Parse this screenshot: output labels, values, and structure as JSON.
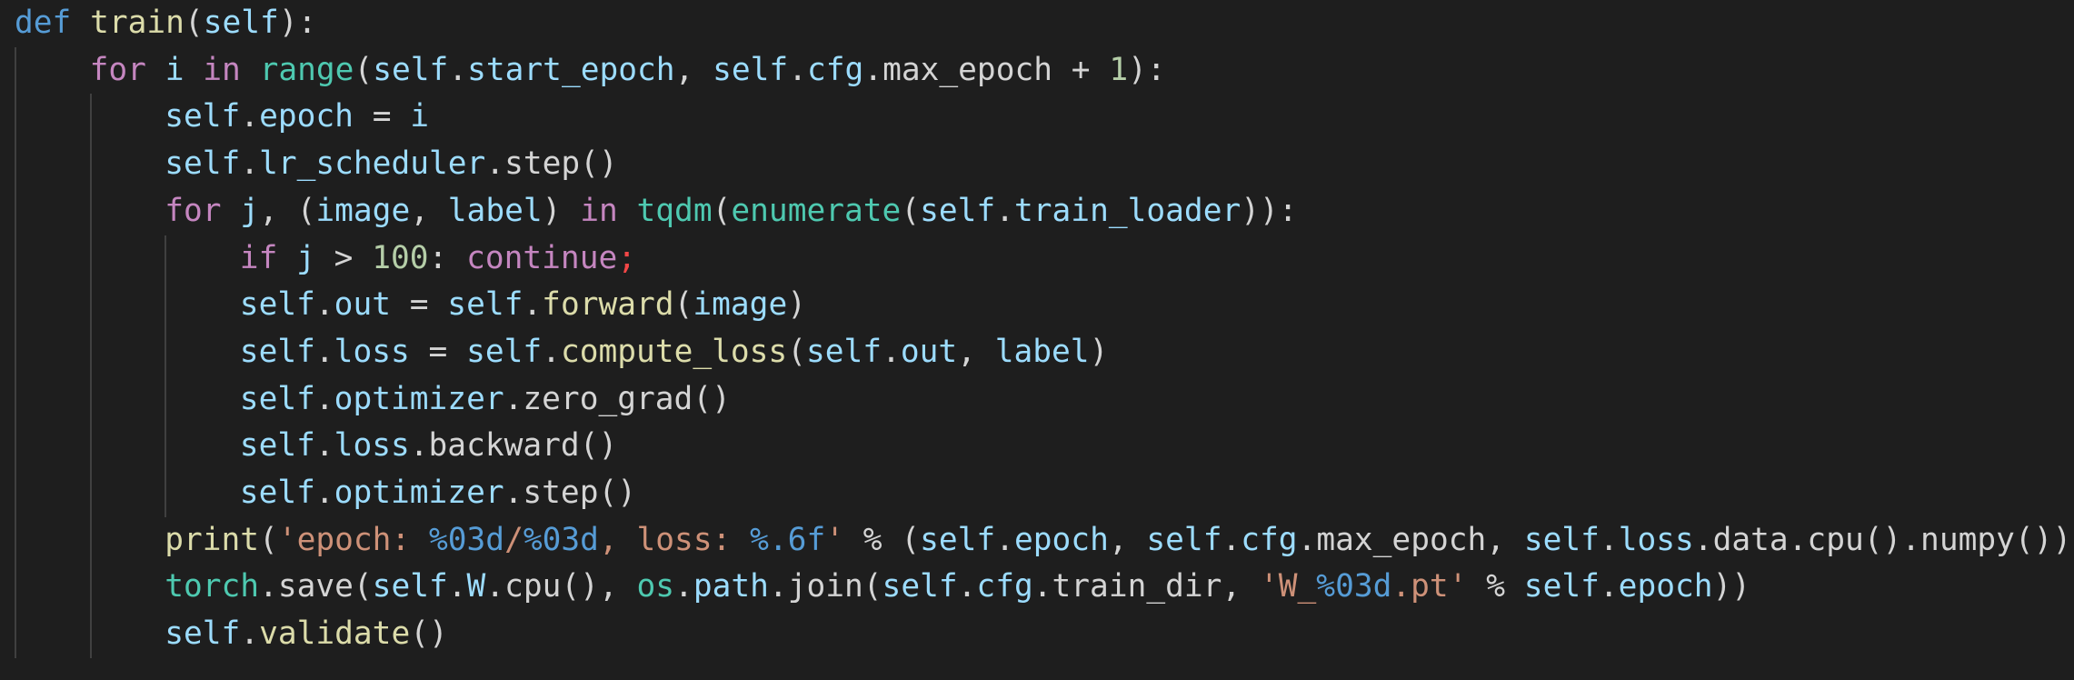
{
  "colors": {
    "background": "#1e1e1e",
    "indent_guide": "#404040",
    "kw_def": "#569cd6",
    "kw_control": "#c586c0",
    "function": "#dcdcaa",
    "variable": "#9cdcfe",
    "builtin_or_module": "#4ec9b0",
    "number": "#b5cea8",
    "string": "#ce9178",
    "format_spec": "#569cd6",
    "punctuation": "#d4d4d4",
    "semicolon_error": "#f44747"
  },
  "code": {
    "lines": [
      {
        "indent": 0,
        "tokens": [
          {
            "t": "def",
            "c": "kw_def"
          },
          {
            "t": " ",
            "c": "punctuation"
          },
          {
            "t": "train",
            "c": "function"
          },
          {
            "t": "(",
            "c": "punctuation"
          },
          {
            "t": "self",
            "c": "variable"
          },
          {
            "t": "):",
            "c": "punctuation"
          }
        ]
      },
      {
        "indent": 1,
        "tokens": [
          {
            "t": "for",
            "c": "kw_control"
          },
          {
            "t": " ",
            "c": "punctuation"
          },
          {
            "t": "i",
            "c": "variable"
          },
          {
            "t": " ",
            "c": "punctuation"
          },
          {
            "t": "in",
            "c": "kw_control"
          },
          {
            "t": " ",
            "c": "punctuation"
          },
          {
            "t": "range",
            "c": "builtin_or_module"
          },
          {
            "t": "(",
            "c": "punctuation"
          },
          {
            "t": "self",
            "c": "variable"
          },
          {
            "t": ".",
            "c": "punctuation"
          },
          {
            "t": "start_epoch",
            "c": "variable"
          },
          {
            "t": ", ",
            "c": "punctuation"
          },
          {
            "t": "self",
            "c": "variable"
          },
          {
            "t": ".",
            "c": "punctuation"
          },
          {
            "t": "cfg",
            "c": "variable"
          },
          {
            "t": ".max_epoch + ",
            "c": "punctuation"
          },
          {
            "t": "1",
            "c": "number"
          },
          {
            "t": "):",
            "c": "punctuation"
          }
        ]
      },
      {
        "indent": 2,
        "tokens": [
          {
            "t": "self",
            "c": "variable"
          },
          {
            "t": ".",
            "c": "punctuation"
          },
          {
            "t": "epoch",
            "c": "variable"
          },
          {
            "t": " = ",
            "c": "punctuation"
          },
          {
            "t": "i",
            "c": "variable"
          }
        ]
      },
      {
        "indent": 2,
        "tokens": [
          {
            "t": "self",
            "c": "variable"
          },
          {
            "t": ".",
            "c": "punctuation"
          },
          {
            "t": "lr_scheduler",
            "c": "variable"
          },
          {
            "t": ".step()",
            "c": "punctuation"
          }
        ]
      },
      {
        "indent": 2,
        "tokens": [
          {
            "t": "for",
            "c": "kw_control"
          },
          {
            "t": " ",
            "c": "punctuation"
          },
          {
            "t": "j",
            "c": "variable"
          },
          {
            "t": ", (",
            "c": "punctuation"
          },
          {
            "t": "image",
            "c": "variable"
          },
          {
            "t": ", ",
            "c": "punctuation"
          },
          {
            "t": "label",
            "c": "variable"
          },
          {
            "t": ") ",
            "c": "punctuation"
          },
          {
            "t": "in",
            "c": "kw_control"
          },
          {
            "t": " ",
            "c": "punctuation"
          },
          {
            "t": "tqdm",
            "c": "builtin_or_module"
          },
          {
            "t": "(",
            "c": "punctuation"
          },
          {
            "t": "enumerate",
            "c": "builtin_or_module"
          },
          {
            "t": "(",
            "c": "punctuation"
          },
          {
            "t": "self",
            "c": "variable"
          },
          {
            "t": ".",
            "c": "punctuation"
          },
          {
            "t": "train_loader",
            "c": "variable"
          },
          {
            "t": ")):",
            "c": "punctuation"
          }
        ]
      },
      {
        "indent": 3,
        "tokens": [
          {
            "t": "if",
            "c": "kw_control"
          },
          {
            "t": " ",
            "c": "punctuation"
          },
          {
            "t": "j",
            "c": "variable"
          },
          {
            "t": " > ",
            "c": "punctuation"
          },
          {
            "t": "100",
            "c": "number"
          },
          {
            "t": ": ",
            "c": "punctuation"
          },
          {
            "t": "continue",
            "c": "kw_control"
          },
          {
            "t": ";",
            "c": "semicolon_error"
          }
        ]
      },
      {
        "indent": 3,
        "tokens": [
          {
            "t": "self",
            "c": "variable"
          },
          {
            "t": ".",
            "c": "punctuation"
          },
          {
            "t": "out",
            "c": "variable"
          },
          {
            "t": " = ",
            "c": "punctuation"
          },
          {
            "t": "self",
            "c": "variable"
          },
          {
            "t": ".",
            "c": "punctuation"
          },
          {
            "t": "forward",
            "c": "function"
          },
          {
            "t": "(",
            "c": "punctuation"
          },
          {
            "t": "image",
            "c": "variable"
          },
          {
            "t": ")",
            "c": "punctuation"
          }
        ]
      },
      {
        "indent": 3,
        "tokens": [
          {
            "t": "self",
            "c": "variable"
          },
          {
            "t": ".",
            "c": "punctuation"
          },
          {
            "t": "loss",
            "c": "variable"
          },
          {
            "t": " = ",
            "c": "punctuation"
          },
          {
            "t": "self",
            "c": "variable"
          },
          {
            "t": ".",
            "c": "punctuation"
          },
          {
            "t": "compute_loss",
            "c": "function"
          },
          {
            "t": "(",
            "c": "punctuation"
          },
          {
            "t": "self",
            "c": "variable"
          },
          {
            "t": ".",
            "c": "punctuation"
          },
          {
            "t": "out",
            "c": "variable"
          },
          {
            "t": ", ",
            "c": "punctuation"
          },
          {
            "t": "label",
            "c": "variable"
          },
          {
            "t": ")",
            "c": "punctuation"
          }
        ]
      },
      {
        "indent": 3,
        "tokens": [
          {
            "t": "self",
            "c": "variable"
          },
          {
            "t": ".",
            "c": "punctuation"
          },
          {
            "t": "optimizer",
            "c": "variable"
          },
          {
            "t": ".zero_grad()",
            "c": "punctuation"
          }
        ]
      },
      {
        "indent": 3,
        "tokens": [
          {
            "t": "self",
            "c": "variable"
          },
          {
            "t": ".",
            "c": "punctuation"
          },
          {
            "t": "loss",
            "c": "variable"
          },
          {
            "t": ".backward()",
            "c": "punctuation"
          }
        ]
      },
      {
        "indent": 3,
        "tokens": [
          {
            "t": "self",
            "c": "variable"
          },
          {
            "t": ".",
            "c": "punctuation"
          },
          {
            "t": "optimizer",
            "c": "variable"
          },
          {
            "t": ".step()",
            "c": "punctuation"
          }
        ]
      },
      {
        "indent": 2,
        "tokens": [
          {
            "t": "print",
            "c": "function"
          },
          {
            "t": "(",
            "c": "punctuation"
          },
          {
            "t": "'epoch: ",
            "c": "string"
          },
          {
            "t": "%03d",
            "c": "format_spec"
          },
          {
            "t": "/",
            "c": "string"
          },
          {
            "t": "%03d",
            "c": "format_spec"
          },
          {
            "t": ", loss: ",
            "c": "string"
          },
          {
            "t": "%.6f",
            "c": "format_spec"
          },
          {
            "t": "'",
            "c": "string"
          },
          {
            "t": " % (",
            "c": "punctuation"
          },
          {
            "t": "self",
            "c": "variable"
          },
          {
            "t": ".",
            "c": "punctuation"
          },
          {
            "t": "epoch",
            "c": "variable"
          },
          {
            "t": ", ",
            "c": "punctuation"
          },
          {
            "t": "self",
            "c": "variable"
          },
          {
            "t": ".",
            "c": "punctuation"
          },
          {
            "t": "cfg",
            "c": "variable"
          },
          {
            "t": ".max_epoch, ",
            "c": "punctuation"
          },
          {
            "t": "self",
            "c": "variable"
          },
          {
            "t": ".",
            "c": "punctuation"
          },
          {
            "t": "loss",
            "c": "variable"
          },
          {
            "t": ".data.cpu().numpy())",
            "c": "punctuation"
          }
        ]
      },
      {
        "indent": 2,
        "tokens": [
          {
            "t": "torch",
            "c": "builtin_or_module"
          },
          {
            "t": ".save(",
            "c": "punctuation"
          },
          {
            "t": "self",
            "c": "variable"
          },
          {
            "t": ".",
            "c": "punctuation"
          },
          {
            "t": "W",
            "c": "variable"
          },
          {
            "t": ".cpu(), ",
            "c": "punctuation"
          },
          {
            "t": "os",
            "c": "builtin_or_module"
          },
          {
            "t": ".",
            "c": "punctuation"
          },
          {
            "t": "path",
            "c": "variable"
          },
          {
            "t": ".join(",
            "c": "punctuation"
          },
          {
            "t": "self",
            "c": "variable"
          },
          {
            "t": ".",
            "c": "punctuation"
          },
          {
            "t": "cfg",
            "c": "variable"
          },
          {
            "t": ".train_dir, ",
            "c": "punctuation"
          },
          {
            "t": "'W_",
            "c": "string"
          },
          {
            "t": "%03d",
            "c": "format_spec"
          },
          {
            "t": ".pt'",
            "c": "string"
          },
          {
            "t": " % ",
            "c": "punctuation"
          },
          {
            "t": "self",
            "c": "variable"
          },
          {
            "t": ".",
            "c": "punctuation"
          },
          {
            "t": "epoch",
            "c": "variable"
          },
          {
            "t": "))",
            "c": "punctuation"
          }
        ]
      },
      {
        "indent": 2,
        "tokens": [
          {
            "t": "self",
            "c": "variable"
          },
          {
            "t": ".",
            "c": "punctuation"
          },
          {
            "t": "validate",
            "c": "function"
          },
          {
            "t": "()",
            "c": "punctuation"
          }
        ]
      }
    ]
  }
}
